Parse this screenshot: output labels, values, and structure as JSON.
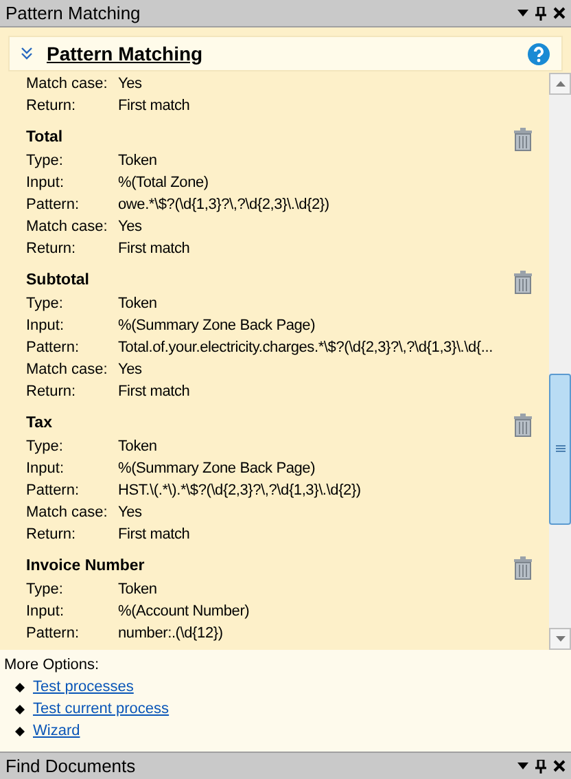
{
  "top_pane": {
    "title": "Pattern Matching"
  },
  "header": {
    "title": "Pattern Matching"
  },
  "entries": [
    {
      "fields": [
        {
          "label": "Match case:",
          "value": "Yes"
        },
        {
          "label": "Return:",
          "value": "First match"
        }
      ]
    },
    {
      "name": "Total",
      "fields": [
        {
          "label": "Type:",
          "value": "Token"
        },
        {
          "label": "Input:",
          "value": "%(Total Zone)"
        },
        {
          "label": "Pattern:",
          "value": "owe.*\\$?(\\d{1,3}?\\,?\\d{2,3}\\.\\d{2})"
        },
        {
          "label": "Match case:",
          "value": "Yes"
        },
        {
          "label": "Return:",
          "value": "First match"
        }
      ]
    },
    {
      "name": "Subtotal",
      "fields": [
        {
          "label": "Type:",
          "value": "Token"
        },
        {
          "label": "Input:",
          "value": "%(Summary Zone Back Page)"
        },
        {
          "label": "Pattern:",
          "value": "Total.of.your.electricity.charges.*\\$?(\\d{2,3}?\\,?\\d{1,3}\\.\\d{..."
        },
        {
          "label": "Match case:",
          "value": "Yes"
        },
        {
          "label": "Return:",
          "value": "First match"
        }
      ]
    },
    {
      "name": "Tax",
      "fields": [
        {
          "label": "Type:",
          "value": "Token"
        },
        {
          "label": "Input:",
          "value": "%(Summary Zone Back Page)"
        },
        {
          "label": "Pattern:",
          "value": "HST.\\(.*\\).*\\$?(\\d{2,3}?\\,?\\d{1,3}\\.\\d{2})"
        },
        {
          "label": "Match case:",
          "value": "Yes"
        },
        {
          "label": "Return:",
          "value": "First match"
        }
      ]
    },
    {
      "name": "Invoice Number",
      "fields": [
        {
          "label": "Type:",
          "value": "Token"
        },
        {
          "label": "Input:",
          "value": "%(Account Number)"
        },
        {
          "label": "Pattern:",
          "value": "number:.(\\d{12})"
        }
      ]
    }
  ],
  "more_options": {
    "title": "More Options:",
    "links": [
      "Test processes",
      "Test current process",
      "Wizard"
    ]
  },
  "bottom_pane": {
    "title": "Find Documents"
  }
}
